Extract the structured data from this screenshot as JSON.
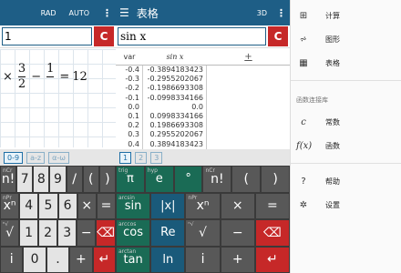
{
  "left": {
    "rad": "RAD",
    "auto": "AUTO",
    "input_value": "1",
    "clear": "C",
    "expr": {
      "a": "×",
      "num": "3",
      "den": "2",
      "minus": "−",
      "b": "1",
      "eq": "=",
      "result": "12"
    },
    "tabs": [
      "0-9",
      "a-z",
      "α-ω"
    ],
    "keys": [
      [
        [
          "n!",
          "nCr"
        ],
        [
          "7",
          ""
        ],
        [
          "8",
          ""
        ],
        [
          "9",
          ""
        ],
        [
          "/",
          ""
        ],
        [
          "(",
          ""
        ],
        [
          ")",
          ""
        ]
      ],
      [
        [
          "xⁿ",
          "nPr"
        ],
        [
          "4",
          ""
        ],
        [
          "5",
          ""
        ],
        [
          "6",
          ""
        ],
        [
          "×",
          ""
        ],
        [
          "=",
          ""
        ]
      ],
      [
        [
          "√",
          "ⁿ√"
        ],
        [
          "1",
          ""
        ],
        [
          "2",
          ""
        ],
        [
          "3",
          ""
        ],
        [
          "−",
          ""
        ],
        [
          "⌫",
          ""
        ]
      ],
      [
        [
          "i",
          ""
        ],
        [
          "0",
          ""
        ],
        [
          ".",
          ""
        ],
        [
          "+",
          ""
        ],
        [
          "↵",
          ""
        ]
      ]
    ]
  },
  "mid": {
    "title": "表格",
    "mode": "3D",
    "input_value": "sin x",
    "clear": "C",
    "col_var": "var",
    "col_fn": "sin x",
    "col_add": "+",
    "rows": [
      [
        "-0.4",
        "-0.3894183423"
      ],
      [
        "-0.3",
        "-0.2955202067"
      ],
      [
        "-0.2",
        "-0.1986693308"
      ],
      [
        "-0.1",
        "-0.0998334166"
      ],
      [
        "0.0",
        "0.0"
      ],
      [
        "0.1",
        "0.0998334166"
      ],
      [
        "0.2",
        "0.1986693308"
      ],
      [
        "0.3",
        "0.2955202067"
      ],
      [
        "0.4",
        "0.3894183423"
      ]
    ],
    "tabs": [
      "1",
      "2",
      "3"
    ],
    "keys": [
      [
        [
          "π",
          "trig"
        ],
        [
          "e",
          "hyp"
        ],
        [
          "°",
          ""
        ],
        [
          "n!",
          "nCr"
        ],
        [
          "(",
          ""
        ],
        [
          ")",
          ""
        ]
      ],
      [
        [
          "sin",
          "arcsin"
        ],
        [
          "|x|",
          ""
        ],
        [
          "xⁿ",
          "nPr"
        ],
        [
          "×",
          ""
        ],
        [
          "=",
          ""
        ]
      ],
      [
        [
          "cos",
          "arccos"
        ],
        [
          "Re",
          ""
        ],
        [
          "√",
          "ⁿ√"
        ],
        [
          "−",
          ""
        ],
        [
          "⌫",
          ""
        ]
      ],
      [
        [
          "tan",
          "arctan"
        ],
        [
          "ln",
          ""
        ],
        [
          "i",
          ""
        ],
        [
          "+",
          ""
        ],
        [
          "↵",
          ""
        ]
      ]
    ]
  },
  "drawer": {
    "items": [
      {
        "icon": "⊞",
        "label": "计算",
        "name": "calculator"
      },
      {
        "icon": "⩫",
        "label": "图形",
        "name": "graph"
      },
      {
        "icon": "▦",
        "label": "表格",
        "name": "table"
      }
    ],
    "section": "函数连接库",
    "lib": [
      {
        "icon": "c",
        "label": "常数",
        "name": "constants"
      },
      {
        "icon": "f(x)",
        "label": "函数",
        "name": "functions"
      }
    ],
    "bottom": [
      {
        "icon": "?",
        "label": "帮助",
        "name": "help"
      },
      {
        "icon": "✲",
        "label": "设置",
        "name": "settings"
      }
    ]
  }
}
